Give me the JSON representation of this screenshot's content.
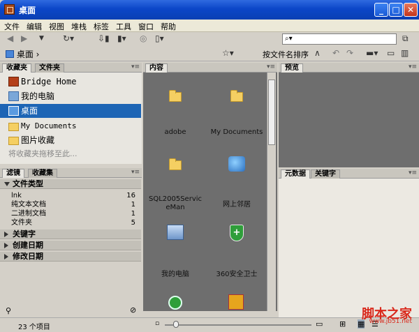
{
  "window": {
    "title": "桌面"
  },
  "menu": [
    "文件",
    "编辑",
    "视图",
    "堆栈",
    "标签",
    "工具",
    "窗口",
    "帮助"
  ],
  "search": {
    "placeholder": ""
  },
  "path": {
    "location": "桌面"
  },
  "sort": {
    "label": "按文件名排序"
  },
  "favorites_panel": {
    "tabs": [
      "收藏夹",
      "文件夹"
    ],
    "items": [
      {
        "label": "Bridge Home",
        "icon": "bridge-home-icon",
        "selected": false
      },
      {
        "label": "我的电脑",
        "icon": "computer-icon",
        "selected": false
      },
      {
        "label": "桌面",
        "icon": "desktop-icon",
        "selected": true
      },
      {
        "label": "My Documents",
        "icon": "folder-icon",
        "selected": false
      },
      {
        "label": "图片收藏",
        "icon": "folder-icon",
        "selected": false
      }
    ],
    "drag_hint": "将收藏夹拖移至此..."
  },
  "filter_panel": {
    "tabs": [
      "滤镜",
      "收藏集"
    ],
    "sections": [
      {
        "label": "文件类型",
        "expanded": true
      },
      {
        "label": "关键字",
        "expanded": false
      },
      {
        "label": "创建日期",
        "expanded": false
      },
      {
        "label": "修改日期",
        "expanded": false
      }
    ],
    "file_types": [
      {
        "name": "lnk",
        "count": "16"
      },
      {
        "name": "纯文本文档",
        "count": "1"
      },
      {
        "name": "二进制文档",
        "count": "1"
      },
      {
        "name": "文件夹",
        "count": "5"
      }
    ]
  },
  "content_panel": {
    "tab": "内容",
    "items": [
      {
        "label": "adobe",
        "icon": "folder-icon"
      },
      {
        "label": "My Documents",
        "icon": "folder-icon"
      },
      {
        "label": "SQL2005ServiceMan",
        "icon": "folder-icon"
      },
      {
        "label": "网上邻居",
        "icon": "network-icon"
      },
      {
        "label": "我的电脑",
        "icon": "computer-icon"
      },
      {
        "label": "360安全卫士",
        "icon": "shield-icon"
      }
    ]
  },
  "preview_panel": {
    "tab": "预览"
  },
  "metadata_panel": {
    "tabs": [
      "元数据",
      "关键字"
    ]
  },
  "status": {
    "item_count": "23 个项目"
  },
  "watermark": {
    "text": "脚本之家",
    "url": "www.jb51.net"
  }
}
